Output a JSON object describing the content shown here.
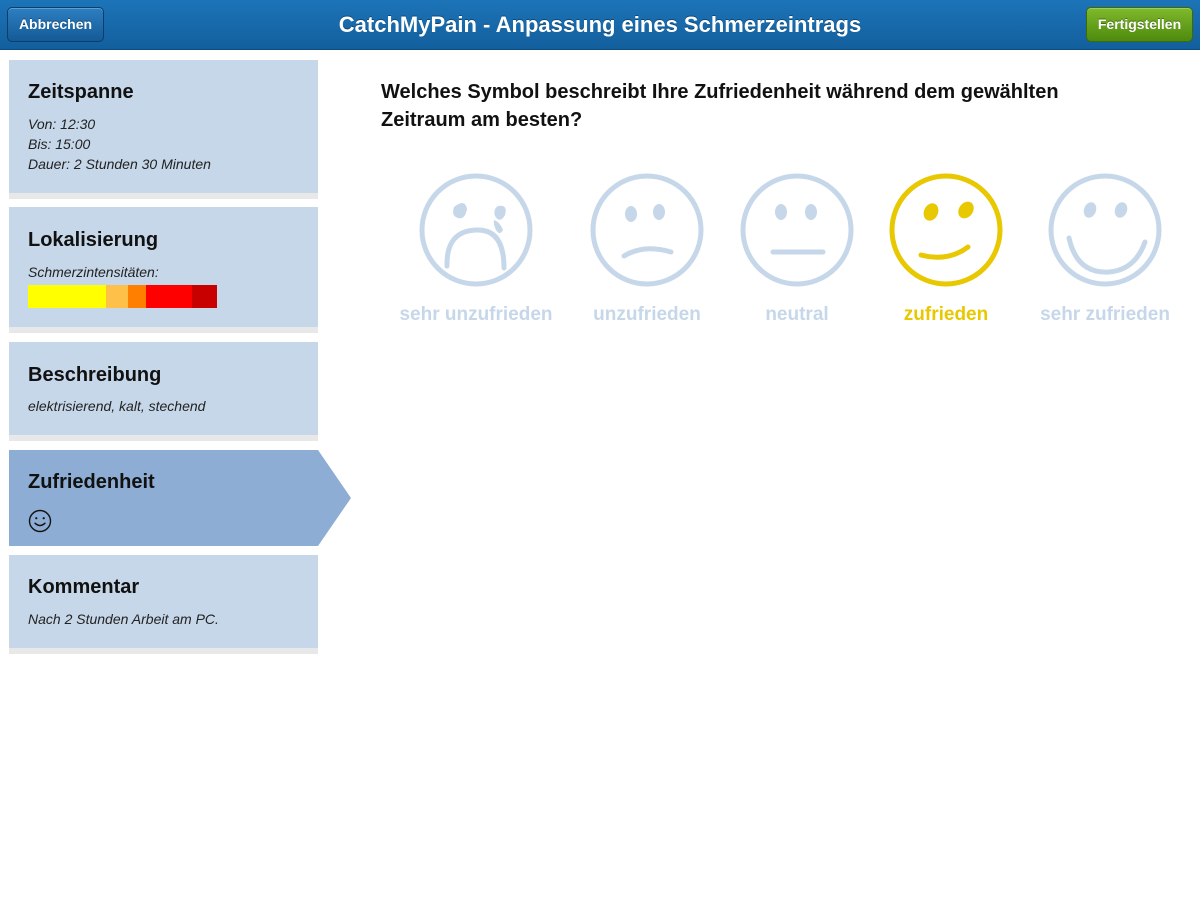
{
  "header": {
    "title": "CatchMyPain - Anpassung eines Schmerzeintrags",
    "cancel_label": "Abbrechen",
    "finish_label": "Fertigstellen"
  },
  "sidebar": {
    "timespan": {
      "title": "Zeitspanne",
      "from": "Von: 12:30",
      "to": "Bis: 15:00",
      "duration": "Dauer: 2 Stunden 30 Minuten"
    },
    "localization": {
      "title": "Lokalisierung",
      "subtitle": "Schmerzintensitäten:",
      "intensity_colors": [
        "#ffff00",
        "#ffc04a",
        "#ff7f00",
        "#ff0000",
        "#c80000"
      ]
    },
    "description": {
      "title": "Beschreibung",
      "text": "elektrisierend, kalt, stechend"
    },
    "satisfaction": {
      "title": "Zufriedenheit",
      "icon": "smiley-icon",
      "active": true
    },
    "comment": {
      "title": "Kommentar",
      "text": "Nach 2 Stunden Arbeit am PC."
    }
  },
  "main": {
    "question": "Welches Symbol beschreibt Ihre Zufriedenheit während dem gewählten Zeitraum am besten?",
    "options": [
      {
        "label": "sehr unzufrieden",
        "icon": "crying-face-icon",
        "selected": false
      },
      {
        "label": "unzufrieden",
        "icon": "sad-face-icon",
        "selected": false
      },
      {
        "label": "neutral",
        "icon": "neutral-face-icon",
        "selected": false
      },
      {
        "label": "zufrieden",
        "icon": "smiling-face-icon",
        "selected": true
      },
      {
        "label": "sehr zufrieden",
        "icon": "big-smile-face-icon",
        "selected": false
      }
    ],
    "colors": {
      "inactive": "#c6d7e9",
      "selected": "#e8c800"
    }
  }
}
